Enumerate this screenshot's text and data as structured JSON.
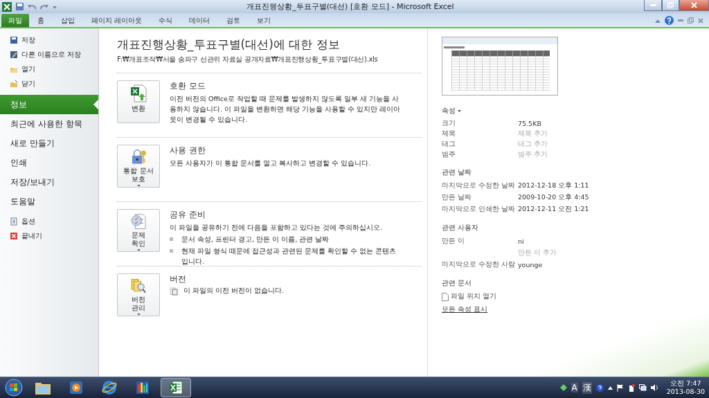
{
  "window": {
    "title": "개표진행상황_투표구별(대선)  [호환 모드]  -  Microsoft Excel"
  },
  "ribbon_tabs": [
    {
      "label": "파일",
      "selected": true
    },
    {
      "label": "홈",
      "selected": false
    },
    {
      "label": "삽입",
      "selected": false
    },
    {
      "label": "페이지 레이아웃",
      "selected": false
    },
    {
      "label": "수식",
      "selected": false
    },
    {
      "label": "데이터",
      "selected": false
    },
    {
      "label": "검토",
      "selected": false
    },
    {
      "label": "보기",
      "selected": false
    }
  ],
  "nav": [
    {
      "label": "저장",
      "kind": "small",
      "selected": false
    },
    {
      "label": "다른 이름으로 저장",
      "kind": "small",
      "selected": false
    },
    {
      "label": "열기",
      "kind": "small",
      "selected": false
    },
    {
      "label": "닫기",
      "kind": "small",
      "selected": false
    },
    {
      "label": "정보",
      "kind": "large",
      "selected": true
    },
    {
      "label": "최근에 사용한 항목",
      "kind": "large",
      "selected": false
    },
    {
      "label": "새로 만들기",
      "kind": "large",
      "selected": false
    },
    {
      "label": "인쇄",
      "kind": "large",
      "selected": false
    },
    {
      "label": "저장/보내기",
      "kind": "large",
      "selected": false
    },
    {
      "label": "도움말",
      "kind": "large",
      "selected": false
    },
    {
      "label": "옵션",
      "kind": "small",
      "selected": false
    },
    {
      "label": "끝내기",
      "kind": "small",
      "selected": false
    }
  ],
  "info": {
    "title": "개표진행상황_투표구별(대선)에 대한 정보",
    "path": "F:₩개표조작₩서울 송파구 선관위 자료실 공개자료₩개표진행상황_투표구별(대선).xls",
    "sections": [
      {
        "button": "변환",
        "dropdown": false,
        "title": "호환 모드",
        "description": "이전 버전의 Office로 작업할 때 문제를 발생하지 않도록 일부 새 기능을 사용하지 않습니다. 이 파일을 변환하면 해당 기능을 사용할 수 있지만 레이아웃이 변경될 수 있습니다."
      },
      {
        "button": "통합 문서\n보호",
        "dropdown": true,
        "title": "사용 권한",
        "description": "모든 사용자가 이 통합 문서를 열고 복사하고 변경할 수 있습니다."
      },
      {
        "button": "문제\n확인",
        "dropdown": true,
        "title": "공유 준비",
        "description": "이 파일을 공유하기 전에 다음을 포함하고 있다는 것에 주의하십시오.",
        "bullets": [
          "문서 속성, 프린터 경고, 만든 이 이름, 관련 날짜",
          "현재 파일 형식 때문에 접근성과 관련된 문제를 확인할 수 없는 콘텐츠입니다."
        ]
      },
      {
        "button": "버전\n관리",
        "dropdown": true,
        "title": "버전",
        "note": "이 파일의 이전 버전이 없습니다."
      }
    ]
  },
  "properties": {
    "groups": [
      {
        "title": "속성",
        "dropdown": true,
        "rows": [
          {
            "label": "크기",
            "value": "75.5KB",
            "kind": "value"
          },
          {
            "label": "제목",
            "placeholder": "제목 추가",
            "kind": "placeholder"
          },
          {
            "label": "태그",
            "placeholder": "태그 추가",
            "kind": "placeholder"
          },
          {
            "label": "범주",
            "placeholder": "범주 추가",
            "kind": "placeholder"
          }
        ]
      },
      {
        "title": "관련 날짜",
        "dropdown": false,
        "rows": [
          {
            "label": "마지막으로 수정한 날짜",
            "value": "2012-12-18 오후 1:11",
            "kind": "value"
          },
          {
            "label": "만든 날짜",
            "value": "2009-10-20 오후 4:45",
            "kind": "value"
          },
          {
            "label": "마지막으로 인쇄한 날짜",
            "value": "2012-12-11 오전 1:21",
            "kind": "value"
          }
        ]
      },
      {
        "title": "관련 사용자",
        "dropdown": false,
        "rows": [
          {
            "label": "만든 이",
            "value": "ni",
            "kind": "value"
          },
          {
            "placeholder": "만든 이 추가",
            "kind": "placeholder"
          },
          {
            "label": "마지막으로 수정한 사람",
            "value": "younge",
            "kind": "value"
          }
        ]
      }
    ],
    "documents_title": "관련 문서",
    "open_location": "파일 위치 열기",
    "show_all": "모든 속성 표시"
  },
  "taskbar": {
    "apps": [
      {
        "selected": false
      },
      {
        "selected": false
      },
      {
        "selected": false
      },
      {
        "selected": false
      },
      {
        "selected": true
      }
    ],
    "ime": [
      "A",
      "漢"
    ],
    "time": "오전 7:47",
    "date": "2013-08-30"
  }
}
